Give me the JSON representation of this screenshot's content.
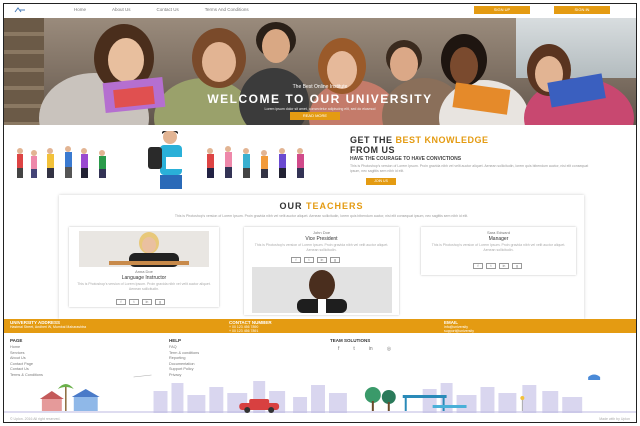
{
  "nav": {
    "links": [
      "Home",
      "About Us",
      "Contact Us",
      "Terms And Conditions"
    ],
    "signup_label": "SIGN UP",
    "signin_label": "SIGN IN"
  },
  "hero": {
    "subtitle": "The Best Online Institute",
    "title": "WELCOME TO OUR UNIVERSITY",
    "description": "Lorem ipsum dolor sit amet, consectetur adipiscing elit, sed do eiusmod",
    "button_label": "READ MORE"
  },
  "knowledge": {
    "title_prefix": "GET THE ",
    "title_accent": "BEST KNOWLEDGE",
    "title_suffix": "FROM US",
    "subtitle": "HAVE THE COURAGE TO HAVE CONVICTIONS",
    "body": "This is Photoshop's version of Lorem Ipsum. Proin gravida nibh vel velit auctor aliquet. Aenean sollicitudin, lorem quis bibendum auctor, nisi elit consequat ipsum, nec sagittis sem nibh id elit.",
    "button_label": "JOIN US"
  },
  "teachers": {
    "heading_prefix": "OUR ",
    "heading_accent": "TEACHERS",
    "description": "This is Photoshop's version of Lorem Ipsum. Proin gravida nibh vel velit auctor aliquet. Aenean sollicitudin, lorem quis bibendum auctor, nisi elit consequat ipsum, nec sagittis sem nibh id elit.",
    "cards": [
      {
        "name": "Anna Doe",
        "role": "Language Instructor",
        "text": "This is Photoshop's version of Lorem Ipsum. Proin gravida nibh vel velit auctor aliquet. Aenean sollicitudin."
      },
      {
        "name": "John Doe",
        "role": "Vice President",
        "text": "This is Photoshop's version of Lorem Ipsum. Proin gravida nibh vel velit auctor aliquet. Aenean sollicitudin."
      },
      {
        "name": "Sara Edward",
        "role": "Manager",
        "text": "This is Photoshop's version of Lorem Ipsum. Proin gravida nibh vel velit auctor aliquet. Aenean sollicitudin."
      }
    ],
    "social_glyphs": [
      "f",
      "t",
      "in",
      "g"
    ]
  },
  "contact": {
    "address_heading": "UNIVERSITY ADDRESS",
    "address_value": "Hastmal Street, Andheri W, Mumbai Maharashtra",
    "number_heading": "CONTACT NUMBER",
    "number_values": [
      "+ 00 123 456 7890",
      "+ 00 123 456 7891"
    ],
    "email_heading": "EMAIL",
    "email_values": [
      "info@university",
      "support@university"
    ]
  },
  "footer": {
    "page_heading": "PAGE",
    "page_links": [
      "Home",
      "Services",
      "About Us",
      "Contact Page",
      "Contact Us",
      "Terms & Conditions"
    ],
    "help_heading": "HELP",
    "help_links": [
      "FAQ",
      "Term & conditions",
      "Reporting",
      "Documentation",
      "Support Policy",
      "Privacy"
    ],
    "team_heading": "TEAM SOLUTIONS",
    "team_socials": [
      "f",
      "t",
      "in",
      "◎"
    ],
    "copyright": "© Uplon. 2016 All right reserved.",
    "made_by": "Made with by Uplon"
  },
  "colors": {
    "accent": "#e49b12"
  }
}
